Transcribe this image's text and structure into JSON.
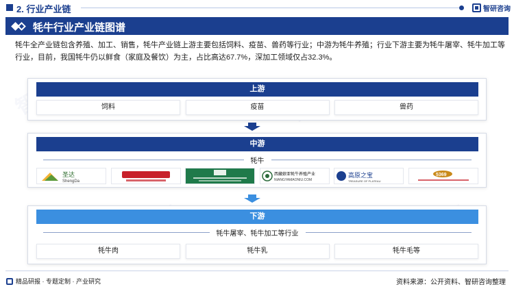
{
  "header": {
    "section_title": "2. 行业产业链",
    "brand_name": "智研咨询"
  },
  "banner": {
    "title": "牦牛行业产业链图谱"
  },
  "intro": {
    "text": "牦牛全产业链包含养殖、加工、销售，牦牛产业链上游主要包括饲料、疫苗、兽药等行业；中游为牦牛养殖；行业下游主要为牦牛屠宰、牦牛加工等行业，目前，我国牦牛仍以鲜食（家庭及餐饮）为主，占比高达67.7%，深加工领域仅占32.3%。"
  },
  "upstream": {
    "title": "上游",
    "items": [
      "饲料",
      "疫苗",
      "兽药"
    ]
  },
  "midstream": {
    "title": "中游",
    "sublabel": "牦牛",
    "logos": [
      {
        "text": "圣达",
        "sub": "ShengDa"
      },
      {
        "text": "",
        "sub": ""
      },
      {
        "text": "",
        "sub": ""
      },
      {
        "text": "西藏娘亚牦牛养殖产业",
        "sub": "NIANGYAMAONIU.COM"
      },
      {
        "text": "高原之宝",
        "sub": "TREASURE OF PLATEAU"
      },
      {
        "text": "5369",
        "sub": ""
      }
    ]
  },
  "downstream": {
    "title": "下游",
    "sublabel": "牦牛屠宰、牦牛加工等行业",
    "items": [
      "牦牛肉",
      "牦牛乳",
      "牦牛毛等"
    ]
  },
  "footer": {
    "left_text": "精品研报 · 专题定制 · 产业研究",
    "source": "资料来源：公开资料、智研咨询整理"
  },
  "colors": {
    "primary": "#1b3f8f",
    "accent": "#3b8fe0"
  }
}
